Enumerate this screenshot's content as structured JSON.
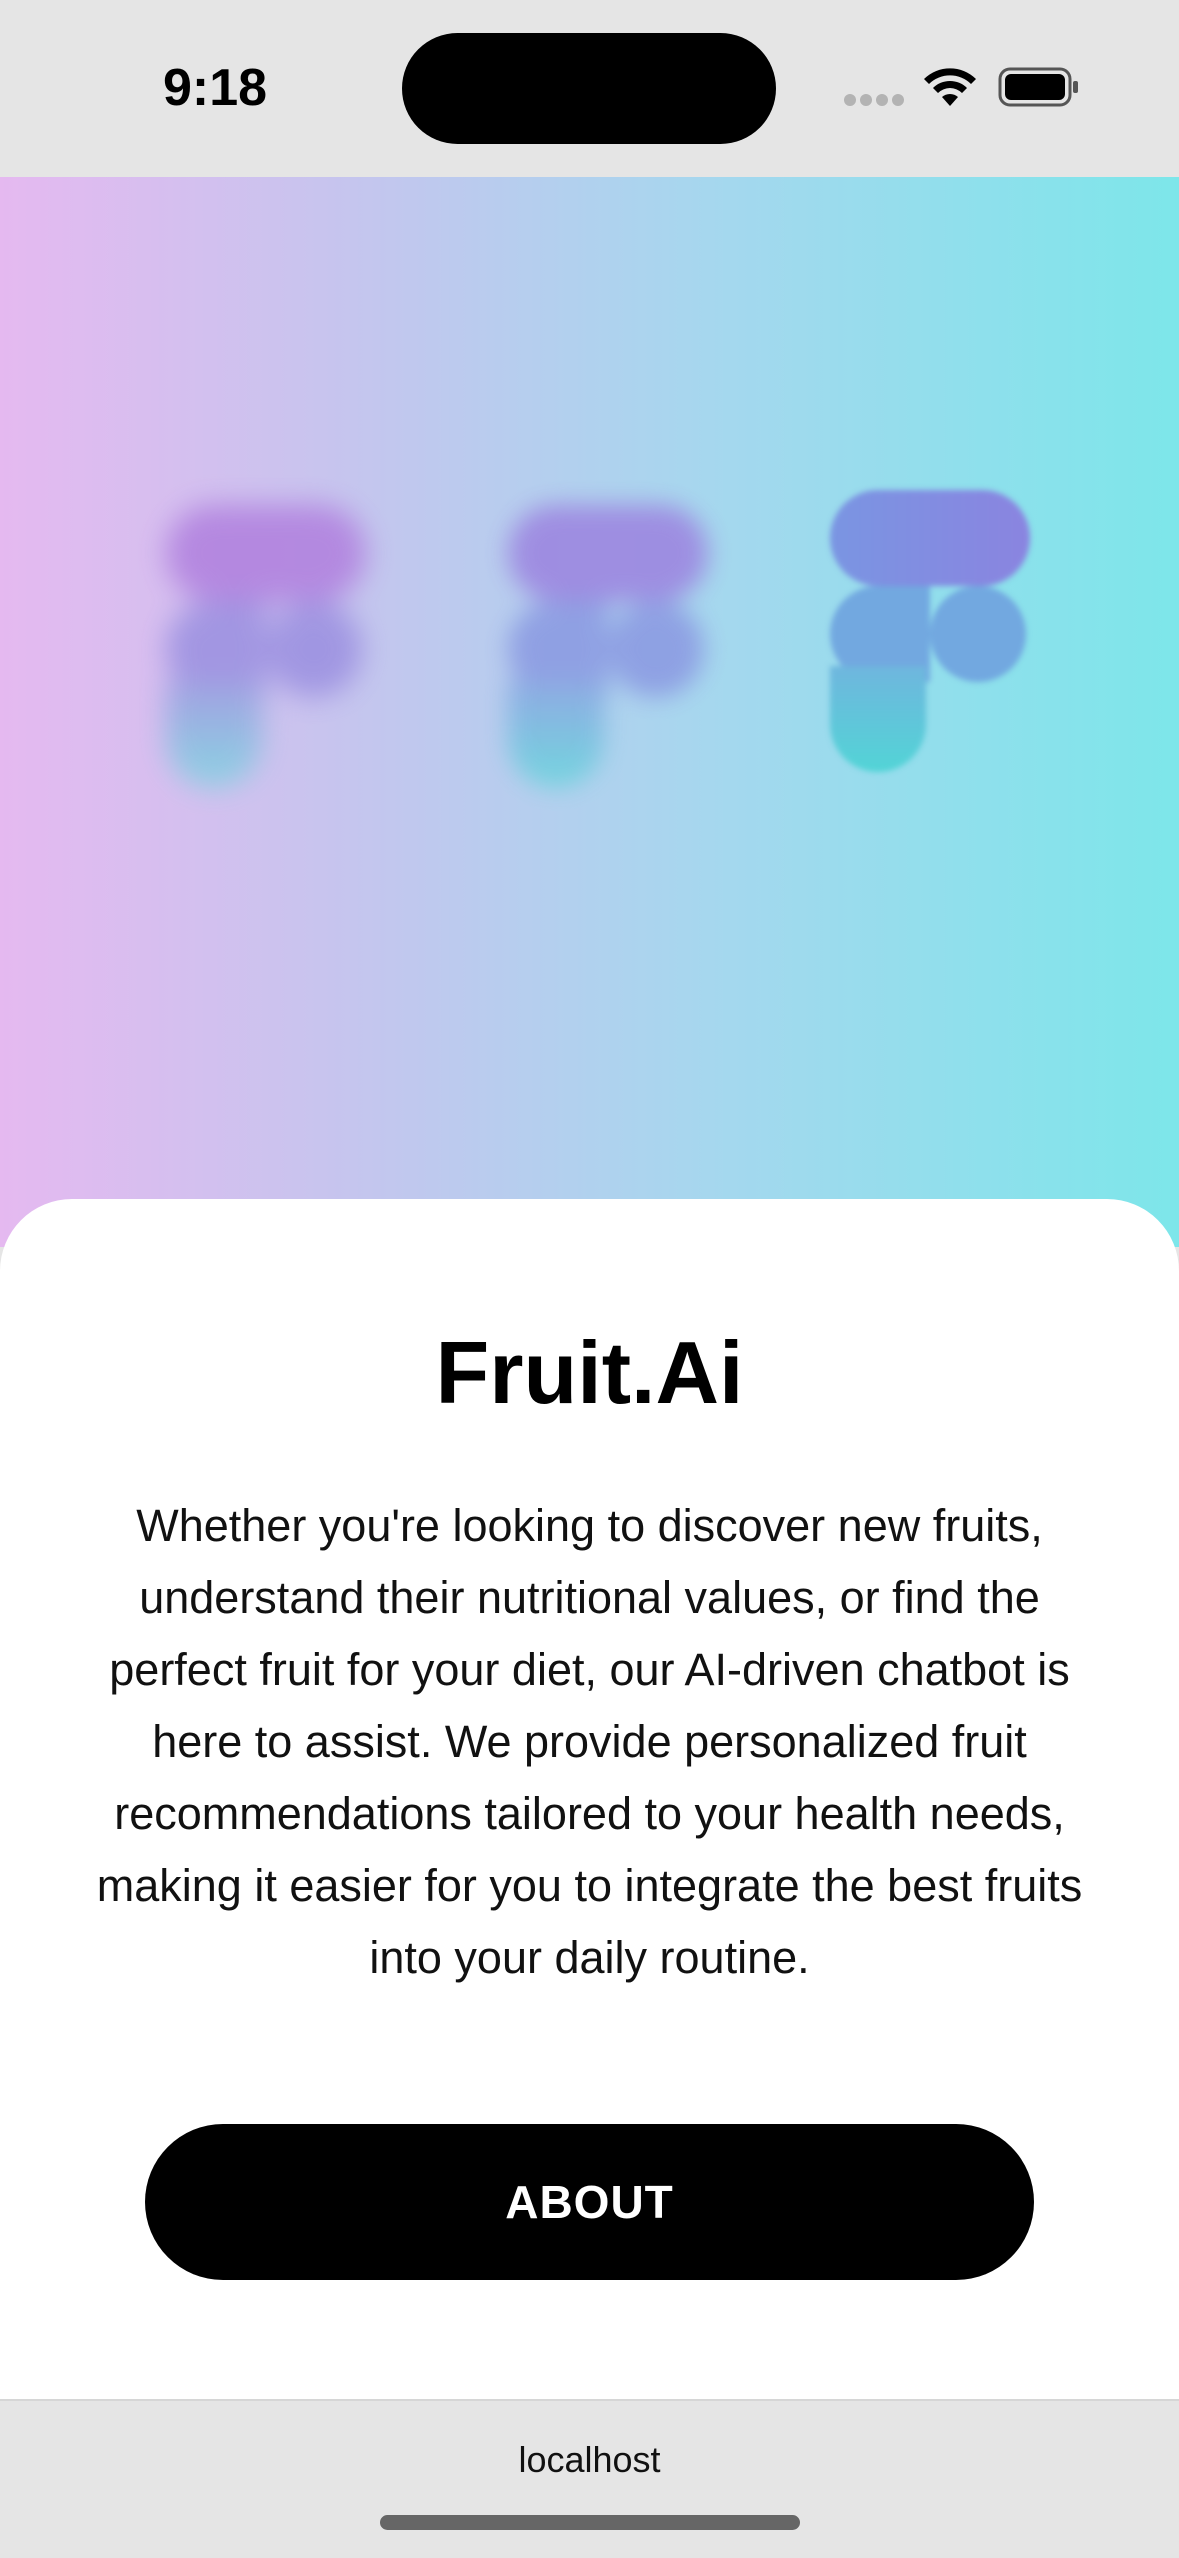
{
  "status_bar": {
    "time": "9:18",
    "icons": [
      "cellular-signal-icon",
      "wifi-icon",
      "battery-icon"
    ]
  },
  "hero": {
    "logos": [
      "figma-logo-icon",
      "figma-logo-icon",
      "figma-logo-icon"
    ],
    "gradient_colors": [
      "#e5b9f0",
      "#c5c5ee",
      "#a6d7ee",
      "#7de6ea"
    ]
  },
  "card": {
    "title": "Fruit.Ai",
    "description": "Whether you're looking to discover new fruits, understand their nutritional values, or find the perfect fruit for your diet, our AI-driven chatbot is here to assist. We provide personalized fruit recommendations tailored to your health needs, making it easier for you to integrate the best fruits into your daily routine.",
    "about_label": "ABOUT"
  },
  "browser": {
    "url": "localhost"
  }
}
